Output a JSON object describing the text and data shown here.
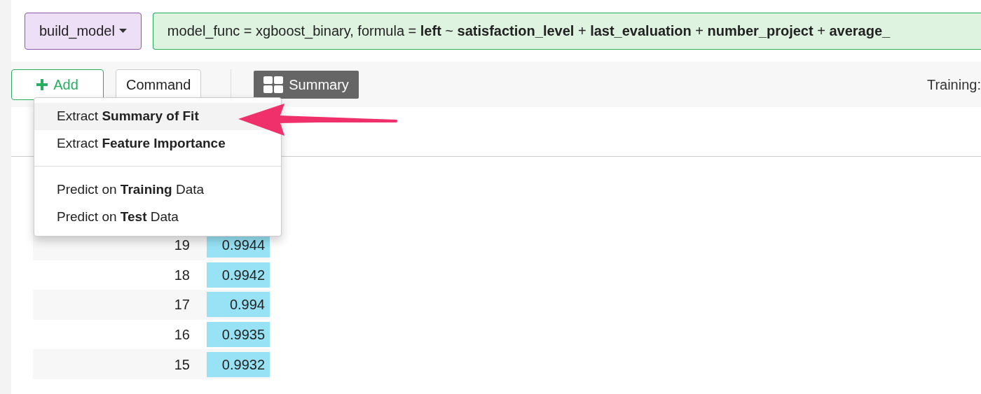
{
  "step": {
    "label": "build_model",
    "formula": "model_func = xgboost_binary, formula = **left** ~ **satisfaction_level** + **last_evaluation** + **number_project** + **average_**"
  },
  "toolbar": {
    "add": "Add",
    "command": "Command",
    "summary": {
      "label": "Summary",
      "selected": true
    },
    "training": "Training:"
  },
  "menu": {
    "groups": [
      [
        {
          "label": "Extract **Summary of Fit**",
          "selected": true
        },
        {
          "label": "Extract **Feature Importance**",
          "selected": false
        }
      ],
      [
        {
          "label": "Predict on **Training** Data",
          "selected": false
        },
        {
          "label": "Predict on **Test** Data",
          "selected": false
        }
      ]
    ]
  },
  "table": {
    "rows": [
      {
        "n": "19",
        "value": "0.9944"
      },
      {
        "n": "18",
        "value": "0.9942"
      },
      {
        "n": "17",
        "value": "0.994"
      },
      {
        "n": "16",
        "value": "0.9935"
      },
      {
        "n": "15",
        "value": "0.9932"
      }
    ]
  }
}
